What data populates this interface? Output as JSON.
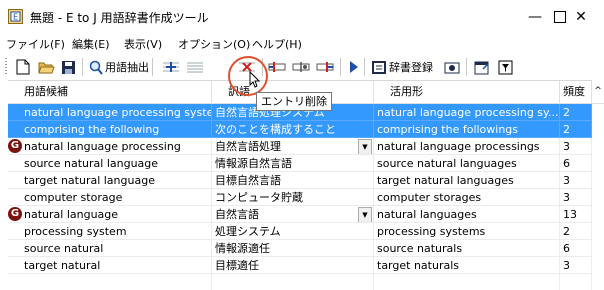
{
  "window": {
    "title": "無題 - E to J 用語辞書作成ツール",
    "minimize": "—",
    "maximize": "☐",
    "close": "✕"
  },
  "menu": [
    "ファイル(F)",
    "編集(E)",
    "表示(V)",
    "オプション(O)",
    "ヘルプ(H)"
  ],
  "toolbar": {
    "extract_label": "用語抽出",
    "dict_register_label": "辞書登録"
  },
  "tooltip": "エントリ削除",
  "columns": [
    "用語候補",
    "訳語",
    "活用形",
    "頻度"
  ],
  "rows": [
    {
      "term": "natural language processing system",
      "translation": "自然言語処理システム",
      "inflection": "natural language processing sy...",
      "freq": "2",
      "selected": true,
      "flag": false,
      "dropdown": false
    },
    {
      "term": "comprising the following",
      "translation": "次のことを構成すること",
      "inflection": "comprising the followings",
      "freq": "2",
      "selected": true,
      "flag": false,
      "dropdown": false
    },
    {
      "term": "natural language processing",
      "translation": "自然言語処理",
      "inflection": "natural language processings",
      "freq": "3",
      "selected": false,
      "flag": true,
      "dropdown": true
    },
    {
      "term": "source natural language",
      "translation": "情報源自然言語",
      "inflection": "source natural languages",
      "freq": "6",
      "selected": false,
      "flag": false,
      "dropdown": false
    },
    {
      "term": "target natural language",
      "translation": "目標自然言語",
      "inflection": "target natural languages",
      "freq": "3",
      "selected": false,
      "flag": false,
      "dropdown": false
    },
    {
      "term": "computer storage",
      "translation": "コンピュータ貯蔵",
      "inflection": "computer storages",
      "freq": "3",
      "selected": false,
      "flag": false,
      "dropdown": false
    },
    {
      "term": "natural language",
      "translation": "自然言語",
      "inflection": "natural languages",
      "freq": "13",
      "selected": false,
      "flag": true,
      "dropdown": true
    },
    {
      "term": "processing system",
      "translation": "処理システム",
      "inflection": "processing systems",
      "freq": "2",
      "selected": false,
      "flag": false,
      "dropdown": false
    },
    {
      "term": "source natural",
      "translation": "情報源適任",
      "inflection": "source naturals",
      "freq": "6",
      "selected": false,
      "flag": false,
      "dropdown": false
    },
    {
      "term": "target natural",
      "translation": "目標適任",
      "inflection": "target naturals",
      "freq": "3",
      "selected": false,
      "flag": false,
      "dropdown": false
    },
    {
      "term": "",
      "translation": "",
      "inflection": "",
      "freq": "",
      "selected": false,
      "flag": false,
      "dropdown": false
    }
  ],
  "colors": {
    "selection": "#3399ff",
    "flag": "#7a1410",
    "highlight_circle": "#e0502e"
  }
}
